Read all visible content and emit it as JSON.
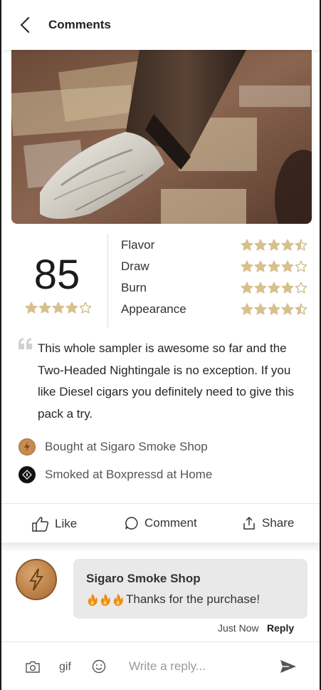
{
  "header": {
    "title": "Comments"
  },
  "review": {
    "score": "85",
    "overall_rating": 4,
    "categories": [
      {
        "label": "Flavor",
        "rating": 4.5
      },
      {
        "label": "Draw",
        "rating": 4
      },
      {
        "label": "Burn",
        "rating": 4
      },
      {
        "label": "Appearance",
        "rating": 4.5
      }
    ],
    "lines": [
      "This whole sampler is awesome so far and the",
      "Two-Headed Nightingale is no exception. If you",
      "like Diesel cigars you definitely need to give this",
      "pack a try."
    ],
    "bought_at": "Bought at Sigaro Smoke Shop",
    "smoked_at": "Smoked at Boxpressd at Home"
  },
  "actions": {
    "like": "Like",
    "comment": "Comment",
    "share": "Share"
  },
  "comment": {
    "author": "Sigaro Smoke Shop",
    "text": "Thanks for the purchase!",
    "time": "Just Now",
    "reply": "Reply"
  },
  "composer": {
    "gif": "gif",
    "placeholder": "Write a reply..."
  },
  "colors": {
    "star": "#d8c08c",
    "star_empty": "#c9b482",
    "accent": "#b07a45"
  }
}
